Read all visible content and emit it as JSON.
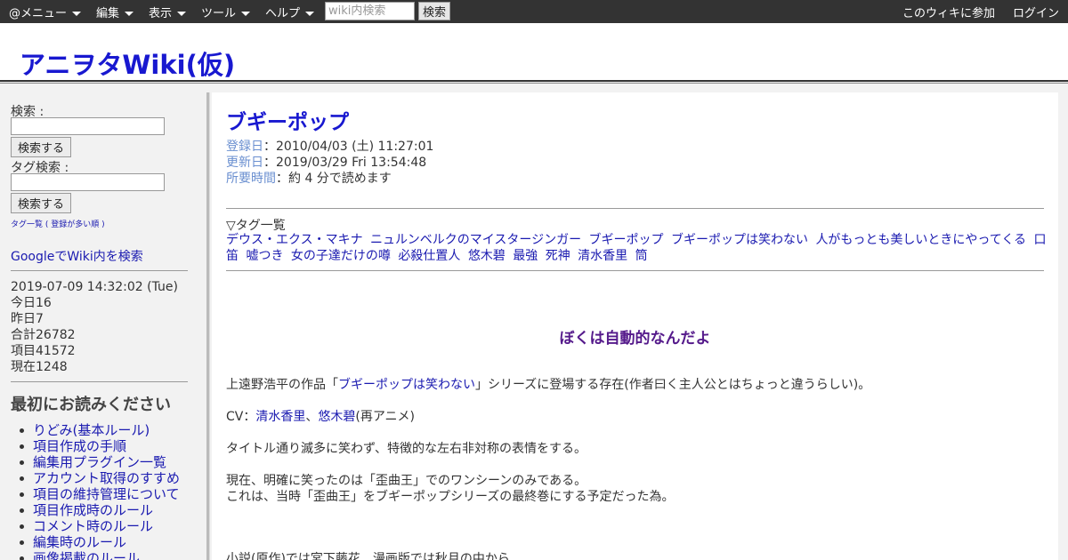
{
  "topbar": {
    "menus": [
      "@メニュー",
      "編集",
      "表示",
      "ツール",
      "ヘルプ"
    ],
    "search_placeholder": "wiki内検索",
    "search_button": "検索",
    "join_link": "このウィキに参加",
    "login_link": "ログイン"
  },
  "header": {
    "site_title": "アニヲタWiki(仮)"
  },
  "sidebar": {
    "search_label": "検索 :",
    "search_button": "検索する",
    "tag_search_label": "タグ検索 :",
    "tag_search_button": "検索する",
    "tag_list_link": "タグ一覧",
    "tag_list_paren_open": " ( ",
    "tag_list_popular_link": "登録が多い順",
    "tag_list_paren_close": " )",
    "google_search_link": "GoogleでWiki内を検索",
    "stats": {
      "datetime": "2019-07-09 14:32:02 (Tue)",
      "today": "今日16",
      "yesterday": "昨日7",
      "total": "合計26782",
      "items": "項目41572",
      "current": "現在1248"
    },
    "read_first_heading": "最初にお読みください",
    "rules": [
      "りどみ(基本ルール)",
      "項目作成の手順",
      "編集用プラグイン一覧",
      "アカウント取得のすすめ",
      "項目の維持管理について",
      "項目作成時のルール",
      "コメント時のルール",
      "編集時のルール",
      "画像掲載のルール"
    ]
  },
  "main": {
    "page_title": "ブギーポップ",
    "meta": {
      "registered_label": "登録日",
      "registered_value": "：2010/04/03 (土) 11:27:01",
      "updated_label": "更新日",
      "updated_value": "：2019/03/29 Fri 13:54:48",
      "reading_label": "所要時間",
      "reading_value": "：約 4 分で読めます"
    },
    "tags_heading": "▽タグ一覧",
    "tags": [
      "デウス・エクス・マキナ",
      "ニュルンベルクのマイスタージンガー",
      "ブギーポップ",
      "ブギーポップは笑わない",
      "人がもっとも美しいときにやってくる",
      "口笛",
      "嘘つき",
      "女の子達だけの噂",
      "必殺仕置人",
      "悠木碧",
      "最強",
      "死神",
      "清水香里",
      "筒"
    ],
    "catchphrase": "ぼくは自動的なんだよ",
    "p1_before": "上遠野浩平の作品「",
    "p1_link": "ブギーポップは笑わない",
    "p1_after": "」シリーズに登場する存在(作者曰く主人公とはちょっと違うらしい)。",
    "cv_prefix": "CV：",
    "cv_link1": "清水香里",
    "cv_sep": "、",
    "cv_link2": "悠木碧",
    "cv_suffix": "(再アニメ)",
    "p2": "タイトル通り滅多に笑わず、特徴的な左右非対称の表情をする。",
    "p3": "現在、明確に笑ったのは「歪曲王」でのワンシーンのみである。",
    "p4": "これは、当時「歪曲王」をブギーポップシリーズの最終巻にする予定だった為。",
    "p5": "小説(原作)では宮下藤花、漫画版では秋月の中から"
  },
  "colors": {
    "topbar_bg": "#333333",
    "title_blue": "#1818d0",
    "link_blue": "#1a1ab0",
    "meta_label": "#6a8fd0",
    "catchphrase_purple": "#551a8b"
  }
}
